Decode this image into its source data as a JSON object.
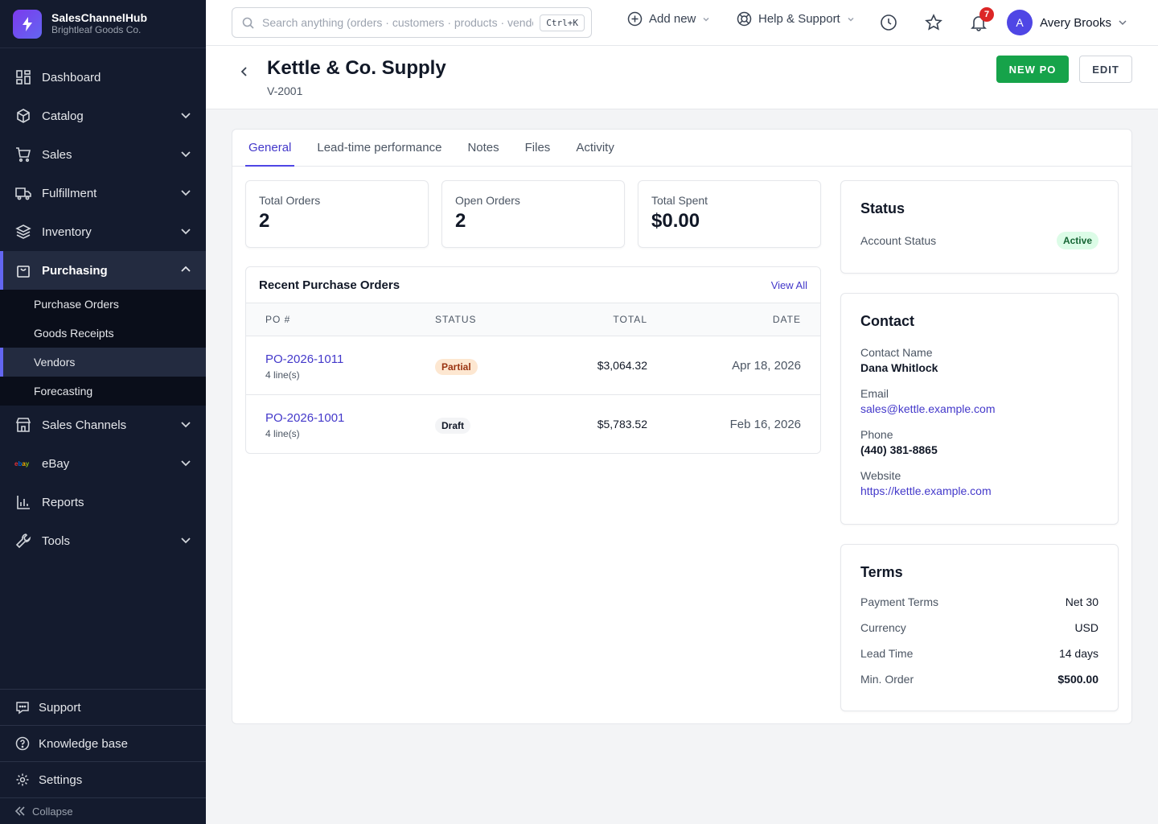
{
  "brand": {
    "name": "SalesChannelHub",
    "company": "Brightleaf Goods Co."
  },
  "sidebar": {
    "items": [
      {
        "label": "Dashboard"
      },
      {
        "label": "Catalog"
      },
      {
        "label": "Sales"
      },
      {
        "label": "Fulfillment"
      },
      {
        "label": "Inventory"
      },
      {
        "label": "Purchasing"
      },
      {
        "label": "Sales Channels"
      },
      {
        "label": "eBay"
      },
      {
        "label": "Reports"
      },
      {
        "label": "Tools"
      }
    ],
    "purchasing_sub": [
      {
        "label": "Purchase Orders"
      },
      {
        "label": "Goods Receipts"
      },
      {
        "label": "Vendors"
      },
      {
        "label": "Forecasting"
      }
    ],
    "bottom": [
      {
        "label": "Support"
      },
      {
        "label": "Knowledge base"
      },
      {
        "label": "Settings"
      }
    ],
    "collapse_label": "Collapse"
  },
  "topbar": {
    "search_placeholder": "Search anything (orders · customers · products · vendors)",
    "search_shortcut": "Ctrl+K",
    "add_new": "Add new",
    "help": "Help & Support",
    "notifications_count": "7",
    "user_initial": "A",
    "user_name": "Avery Brooks"
  },
  "header": {
    "title": "Kettle & Co. Supply",
    "vendor_id": "V-2001",
    "new_po": "NEW PO",
    "edit": "EDIT"
  },
  "tabs": [
    {
      "label": "General"
    },
    {
      "label": "Lead-time performance"
    },
    {
      "label": "Notes"
    },
    {
      "label": "Files"
    },
    {
      "label": "Activity"
    }
  ],
  "stats": [
    {
      "label": "Total Orders",
      "value": "2"
    },
    {
      "label": "Open Orders",
      "value": "2"
    },
    {
      "label": "Total Spent",
      "value": "$0.00"
    }
  ],
  "recent_pos": {
    "title": "Recent Purchase Orders",
    "view_all": "View All",
    "headers": {
      "po": "PO #",
      "status": "STATUS",
      "total": "TOTAL",
      "date": "DATE"
    },
    "rows": [
      {
        "po": "PO-2026-1011",
        "lines": "4 line(s)",
        "status": "Partial",
        "total": "$3,064.32",
        "date": "Apr 18, 2026"
      },
      {
        "po": "PO-2026-1001",
        "lines": "4 line(s)",
        "status": "Draft",
        "total": "$5,783.52",
        "date": "Feb 16, 2026"
      }
    ]
  },
  "status_card": {
    "title": "Status",
    "label": "Account Status",
    "value": "Active"
  },
  "contact_card": {
    "title": "Contact",
    "name_label": "Contact Name",
    "name": "Dana Whitlock",
    "email_label": "Email",
    "email": "sales@kettle.example.com",
    "phone_label": "Phone",
    "phone": "(440) 381-8865",
    "website_label": "Website",
    "website": "https://kettle.example.com"
  },
  "terms_card": {
    "title": "Terms",
    "rows": [
      {
        "label": "Payment Terms",
        "value": "Net 30"
      },
      {
        "label": "Currency",
        "value": "USD"
      },
      {
        "label": "Lead Time",
        "value": "14 days"
      },
      {
        "label": "Min. Order",
        "value": "$500.00"
      }
    ]
  },
  "colors": {
    "accent": "#4f46e5",
    "sidebar_bg": "#141b2e",
    "primary_green": "#16a34a"
  }
}
